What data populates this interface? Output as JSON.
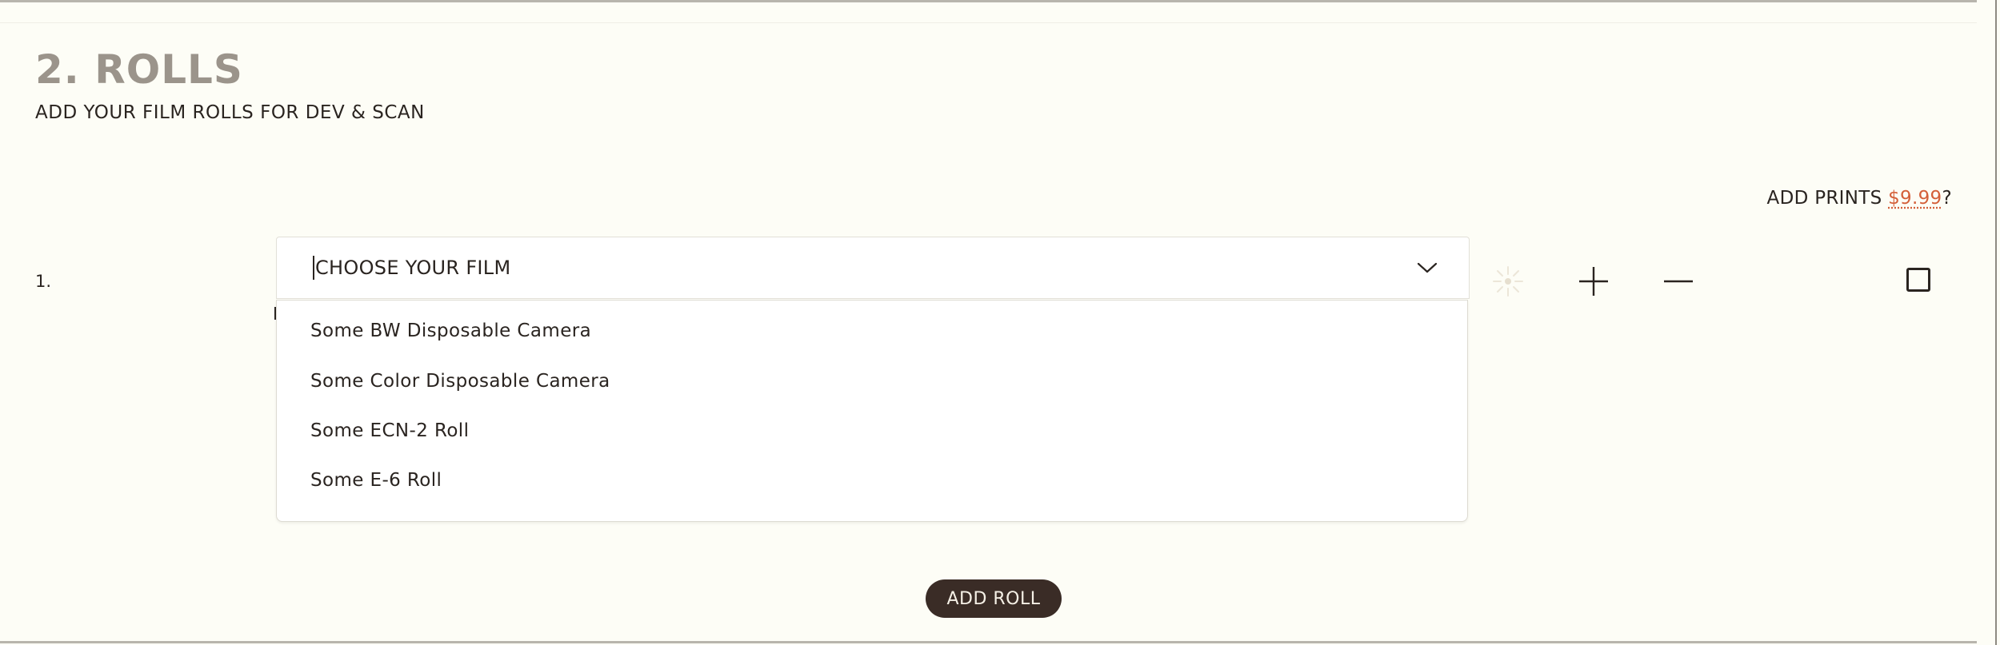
{
  "section": {
    "title": "2. ROLLS",
    "subtitle": "ADD YOUR FILM ROLLS FOR DEV & SCAN"
  },
  "prints": {
    "label": "ADD PRINTS ",
    "price": "$9.99",
    "suffix": "?"
  },
  "rolls": [
    {
      "number": "1.",
      "film_select": {
        "placeholder": "CHOOSE YOUR FILM",
        "options": [
          "Some BW Disposable Camera",
          "Some Color Disposable Camera",
          "Some ECN-2 Roll",
          "Some E-6 Roll"
        ]
      },
      "icons": {
        "push_pull": "sun-icon",
        "push": "plus-icon",
        "pull": "minus-icon"
      },
      "prints_checked": false
    }
  ],
  "actions": {
    "add_roll": "ADD ROLL"
  },
  "colors": {
    "background": "#fdfdf6",
    "heading": "#9b948b",
    "text": "#2a2420",
    "accent_price": "#d4603a",
    "button_bg": "#3a2c26",
    "button_text": "#f5f0e6"
  }
}
